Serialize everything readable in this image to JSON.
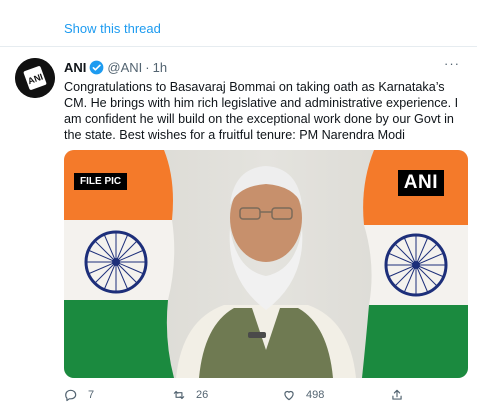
{
  "thread": {
    "show_label": "Show this thread"
  },
  "tweet": {
    "author_name": "ANI",
    "handle": "@ANI",
    "separator": "·",
    "time": "1h",
    "text": "Congratulations to Basavaraj Bommai on taking oath as Karnataka’s CM. He brings with him rich legislative and administrative experience. I am confident he will build on the exceptional work done by our Govt in the state. Best wishes for a fruitful tenure: PM Narendra Modi",
    "more_icon": "···"
  },
  "avatar": {
    "logo_text": "ANI"
  },
  "media": {
    "file_label": "FILE PIC",
    "brand_label": "ANI"
  },
  "actions": {
    "reply_count": "7",
    "retweet_count": "26",
    "like_count": "498"
  },
  "colors": {
    "link": "#1d9bf0",
    "verified": "#1d9bf0",
    "saffron": "#f47a2a",
    "green": "#1b8a3f",
    "chakra": "#1d2f7a"
  }
}
